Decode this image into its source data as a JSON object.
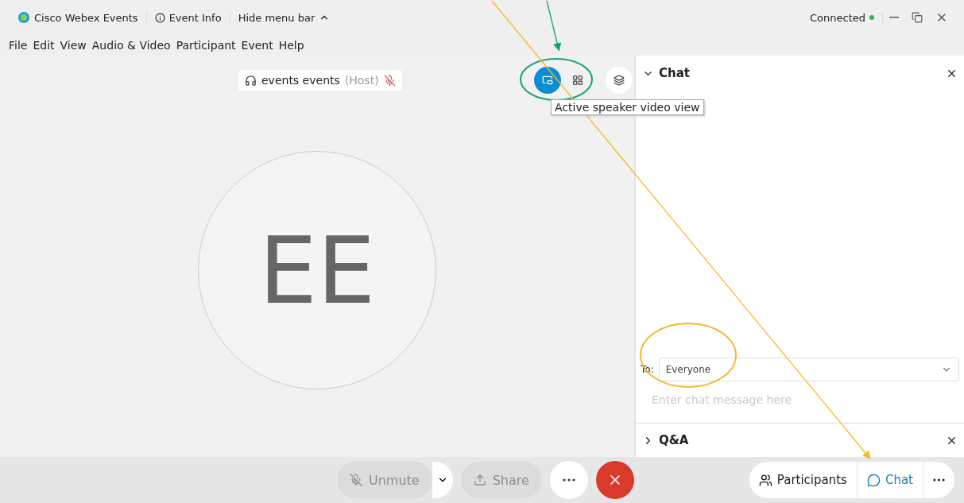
{
  "title_bar": {
    "app_name": "Cisco Webex Events",
    "event_info": "Event Info",
    "hide_menu": "Hide menu bar",
    "status": "Connected"
  },
  "menu": [
    "File",
    "Edit",
    "View",
    "Audio & Video",
    "Participant",
    "Event",
    "Help"
  ],
  "stage": {
    "speaker": {
      "name": "events events",
      "role": "(Host)",
      "muted": true
    },
    "view_buttons": [
      {
        "kind": "speaker",
        "selected": true
      },
      {
        "kind": "grid",
        "selected": false
      },
      {
        "kind": "popout",
        "selected": false
      }
    ],
    "tooltip": "Active speaker video view",
    "initials": "EE"
  },
  "chat_panel": {
    "title": "Chat",
    "expanded": true,
    "to_label": "To:",
    "recipient": "Everyone",
    "placeholder": "Enter chat message here"
  },
  "qa_panel": {
    "title": "Q&A",
    "expanded": false
  },
  "controls": [
    {
      "kind": "mute",
      "label": "Unmute",
      "disabled": true
    },
    {
      "kind": "share",
      "label": "Share",
      "disabled": true
    },
    {
      "kind": "more",
      "disabled": false
    },
    {
      "kind": "leave",
      "disabled": false
    }
  ],
  "side_controls": [
    {
      "kind": "participants",
      "label": "Participants",
      "selected": false
    },
    {
      "kind": "chat",
      "label": "Chat",
      "selected": true
    },
    {
      "kind": "more",
      "selected": false
    }
  ]
}
